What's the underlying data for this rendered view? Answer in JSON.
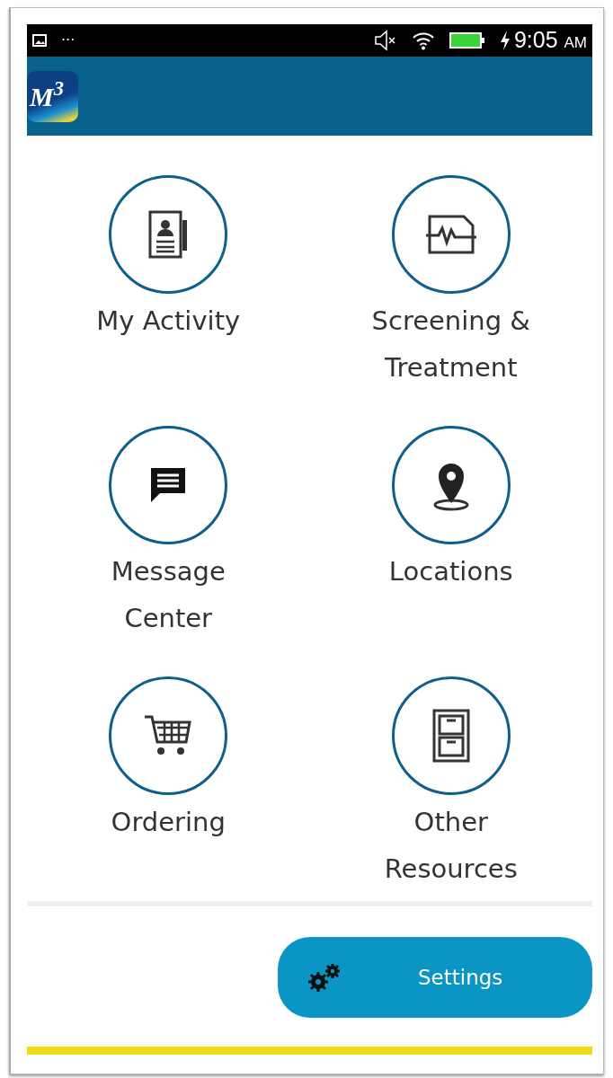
{
  "status_bar": {
    "time": "9:05",
    "meridiem": "AM",
    "dots": "···"
  },
  "app_bar": {
    "logo": "M$^{3}$"
  },
  "tiles": [
    {
      "label": "My Activity"
    },
    {
      "label": "Screening & Treatment"
    },
    {
      "label": "Message Center"
    },
    {
      "label": "Locations"
    },
    {
      "label": "Ordering"
    },
    {
      "label": "Other Resources"
    }
  ],
  "settings_button": {
    "label": "Settings"
  }
}
